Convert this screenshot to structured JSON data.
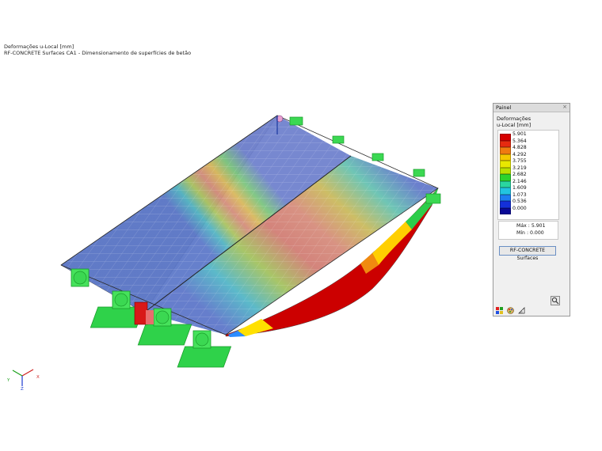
{
  "header": {
    "line1": "Deformações u-Local [mm]",
    "line2": "RF-CONCRETE Surfaces CA1 - Dimensionamento de superfícies de betão"
  },
  "panel": {
    "title": "Painel",
    "close_glyph": "×",
    "heading": "Deformações",
    "subheading": "u-Local [mm]",
    "legend": [
      {
        "value": "5.901",
        "color": "#d60000"
      },
      {
        "value": "5.364",
        "color": "#e62a10"
      },
      {
        "value": "4.828",
        "color": "#f07a10"
      },
      {
        "value": "4.292",
        "color": "#f5c800"
      },
      {
        "value": "3.755",
        "color": "#e8e800"
      },
      {
        "value": "3.219",
        "color": "#b7e000"
      },
      {
        "value": "2.682",
        "color": "#2cd32c"
      },
      {
        "value": "2.146",
        "color": "#2ad6a0"
      },
      {
        "value": "1.609",
        "color": "#22c4e0"
      },
      {
        "value": "1.073",
        "color": "#1e7df0"
      },
      {
        "value": "0.536",
        "color": "#1430d8"
      },
      {
        "value": "0.000",
        "color": "#0a0a96"
      }
    ],
    "max_label": "Máx",
    "max_value": "5.901",
    "min_label": "Mín",
    "min_value": "0.000",
    "colon": ":",
    "button_label": "RF-CONCRETE Surfaces"
  },
  "axes": {
    "x": "X",
    "y": "Y",
    "z": "Z"
  },
  "icons": [
    "table-icon",
    "palette-icon",
    "ruler-icon",
    "zoom-icon"
  ]
}
